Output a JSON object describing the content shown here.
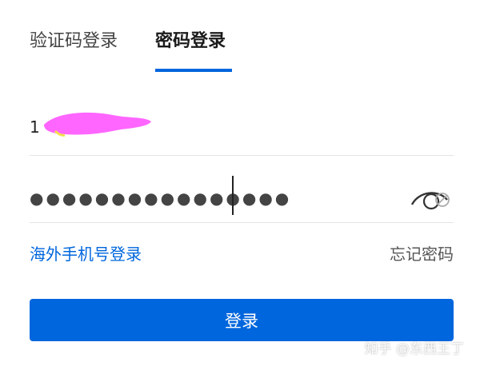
{
  "tabs": {
    "sms_label": "验证码登录",
    "password_label": "密码登录",
    "active": "password"
  },
  "phone": {
    "prefix": "1",
    "redacted": true
  },
  "password": {
    "masked_value": "●●●●●●●●●●●●●●●●",
    "toggle_icon": "eye-icon"
  },
  "links": {
    "overseas_login": "海外手机号登录",
    "forgot_password": "忘记密码"
  },
  "login_button": {
    "label": "登录"
  },
  "watermark": "知乎 @东西王丁",
  "colors": {
    "accent": "#0066dd",
    "redaction": "#ff66ff"
  }
}
